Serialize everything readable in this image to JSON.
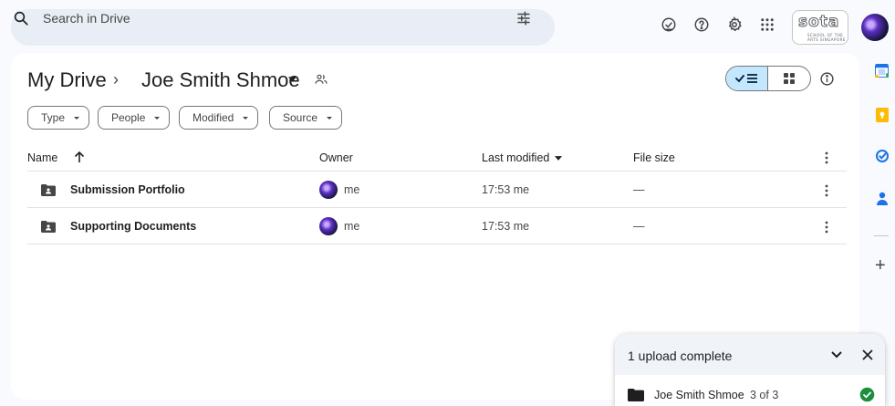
{
  "search": {
    "placeholder": "Search in Drive"
  },
  "header": {
    "icons": [
      "offline-ready-icon",
      "help-icon",
      "settings-icon",
      "apps-grid-icon"
    ],
    "org_logo": {
      "text": "sota",
      "sub1": "SCHOOL OF THE",
      "sub2": "ARTS SINGAPORE"
    }
  },
  "breadcrumb": {
    "root": "My Drive",
    "separator": "›",
    "current": "Joe Smith Shmoe"
  },
  "view": {
    "mode": "list"
  },
  "filters": [
    {
      "label": "Type"
    },
    {
      "label": "People"
    },
    {
      "label": "Modified"
    },
    {
      "label": "Source"
    }
  ],
  "table": {
    "columns": {
      "name": "Name",
      "owner": "Owner",
      "modified": "Last modified",
      "size": "File size"
    },
    "rows": [
      {
        "name": "Submission Portfolio",
        "owner": "me",
        "modified": "17:53 me",
        "size": "—"
      },
      {
        "name": "Supporting Documents",
        "owner": "me",
        "modified": "17:53 me",
        "size": "—"
      }
    ]
  },
  "side_panel": {
    "apps": [
      "calendar-icon",
      "keep-icon",
      "tasks-icon",
      "contacts-icon"
    ],
    "add": "+"
  },
  "upload": {
    "title": "1 upload complete",
    "item_name": "Joe Smith Shmoe",
    "item_count": "3 of 3"
  },
  "colors": {
    "accent": "#0b57d0",
    "selected": "#c2e7ff",
    "success": "#1e8e3e",
    "background": "#f8fafd"
  }
}
